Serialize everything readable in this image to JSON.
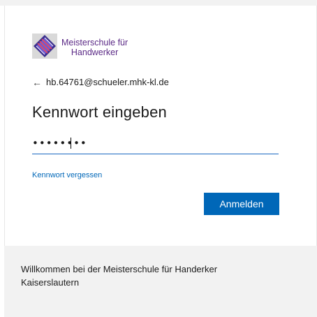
{
  "brand": {
    "name_line1": "Meisterschule für",
    "name_line2": "Handwerker"
  },
  "identity": {
    "back_icon": "←",
    "email": "hb.64761@schueler.mhk-kl.de"
  },
  "heading": {
    "title": "Kennwort eingeben"
  },
  "password": {
    "value": "••••••••"
  },
  "links": {
    "forgot_password": "Kennwort vergessen"
  },
  "actions": {
    "sign_in_label": "Anmelden"
  },
  "footer": {
    "welcome_text": "Willkommen bei der Meisterschule für Handerker Kaiserslautern"
  },
  "colors": {
    "accent": "#0067b8",
    "brand_text": "#5b2a86",
    "footer_bg": "#f2f2f2"
  }
}
